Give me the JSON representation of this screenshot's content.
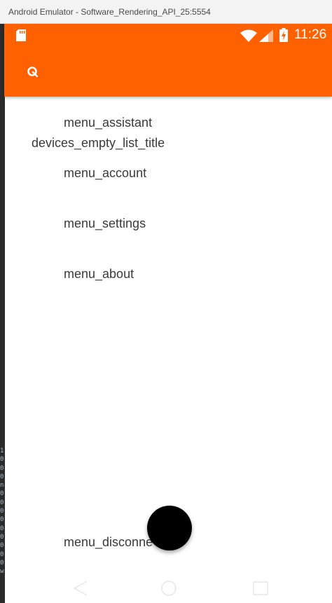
{
  "window": {
    "title": "Android Emulator - Software_Rendering_API_25:5554"
  },
  "status_bar": {
    "time": "11:26",
    "icons": [
      "sd-card-icon",
      "wifi-icon",
      "cell-signal-icon",
      "battery-charging-icon"
    ]
  },
  "app_bar": {
    "background_color": "#ff6000",
    "logo_icon": "app-logo-icon"
  },
  "menu": {
    "assistant": "menu_assistant",
    "empty_list_title": "devices_empty_list_title",
    "account": "menu_account",
    "settings": "menu_settings",
    "about": "menu_about",
    "disconnect": "menu_disconne"
  },
  "fab": {
    "color": "#000000"
  },
  "navigation_bar": {
    "icons": [
      "back-icon",
      "home-icon",
      "recents-icon"
    ]
  }
}
